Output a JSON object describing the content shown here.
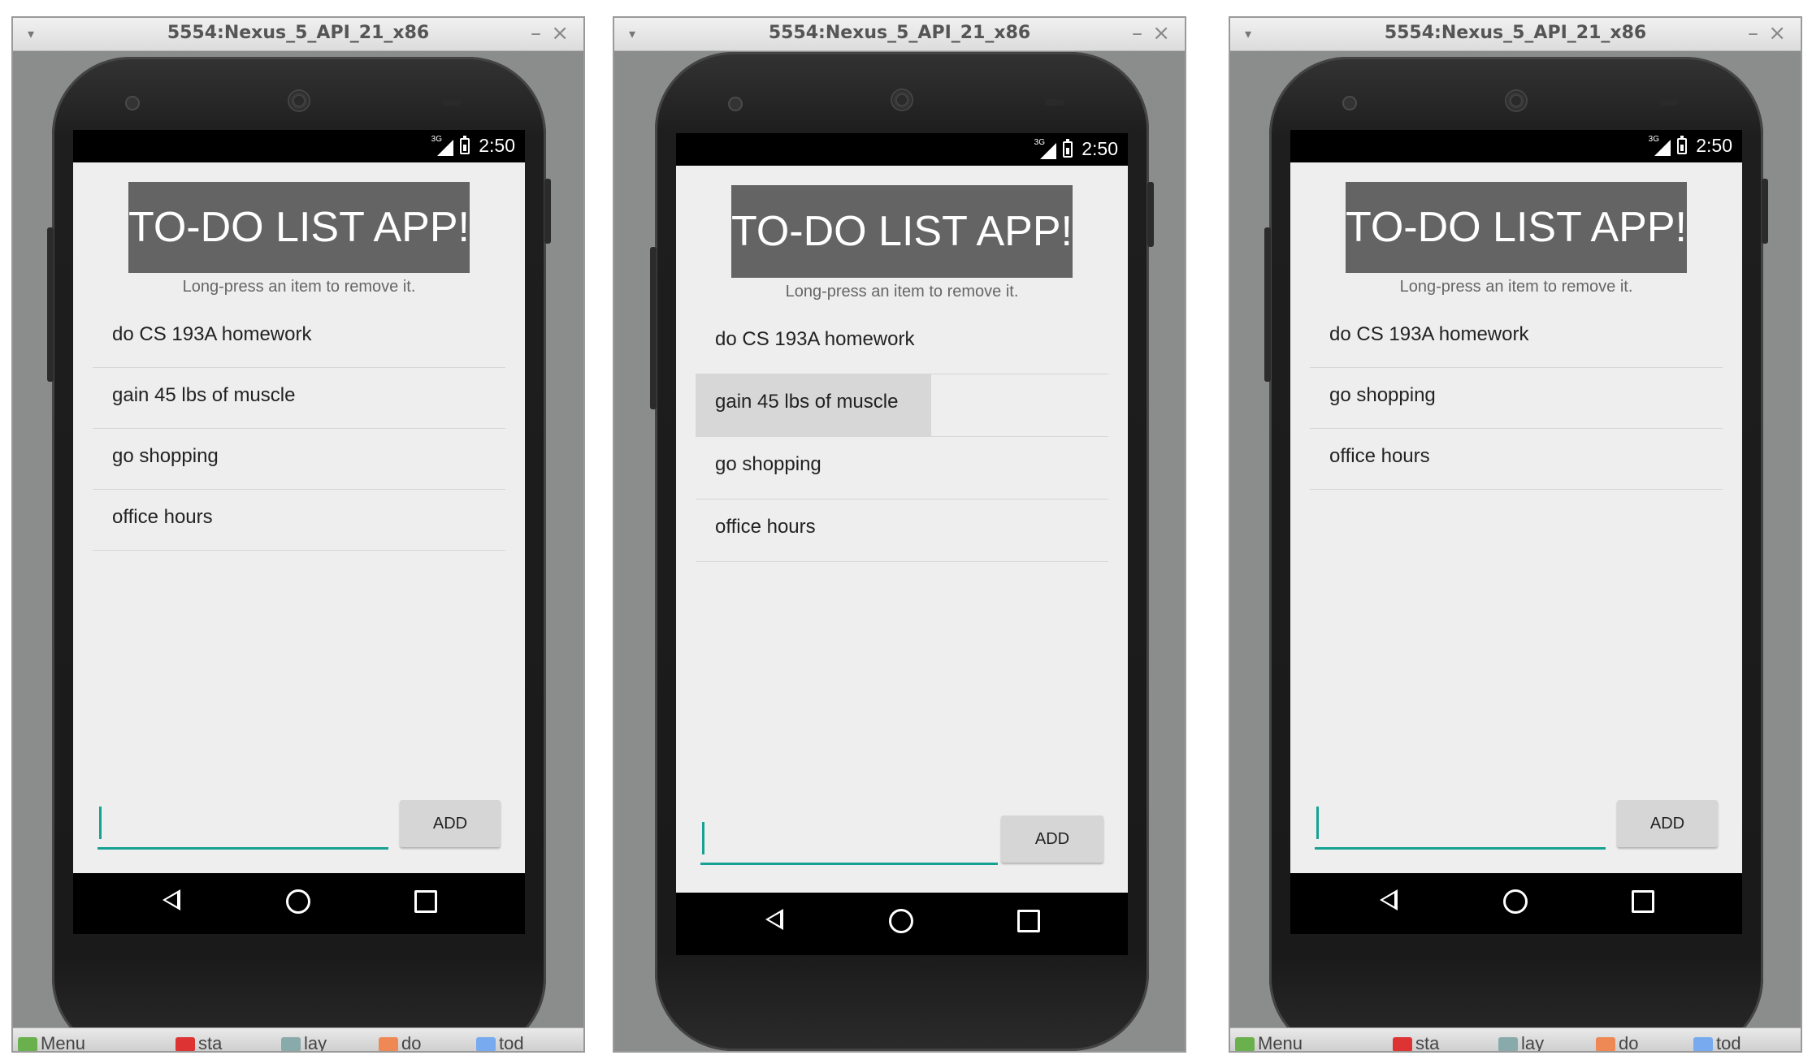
{
  "window": {
    "title": "5554:Nexus_5_API_21_x86",
    "minimize_glyph": "–",
    "close_glyph": "×",
    "menu_glyph": "▾"
  },
  "status": {
    "network": "3G",
    "time": "2:50"
  },
  "app": {
    "title": "TO-DO LIST APP!",
    "hint": "Long-press an item to remove it.",
    "add_label": "ADD",
    "input_value": "",
    "input_placeholder": ""
  },
  "panels": [
    {
      "items": [
        "do CS 193A homework",
        "gain 45 lbs of muscle",
        "go shopping",
        "office hours"
      ],
      "pressed_item": ""
    },
    {
      "items": [
        "do CS 193A homework",
        "gain 45 lbs of muscle",
        "go shopping",
        "office hours"
      ],
      "pressed_item": "gain 45 lbs of muscle"
    },
    {
      "items": [
        "do CS 193A homework",
        "go shopping",
        "office hours"
      ],
      "pressed_item": ""
    }
  ],
  "taskbar": {
    "menu": "Menu",
    "items": [
      "sta",
      "lay",
      "do",
      "tod"
    ]
  },
  "colors": {
    "accent": "#16a293",
    "banner": "#646464",
    "app_bg": "#eeeeee"
  }
}
